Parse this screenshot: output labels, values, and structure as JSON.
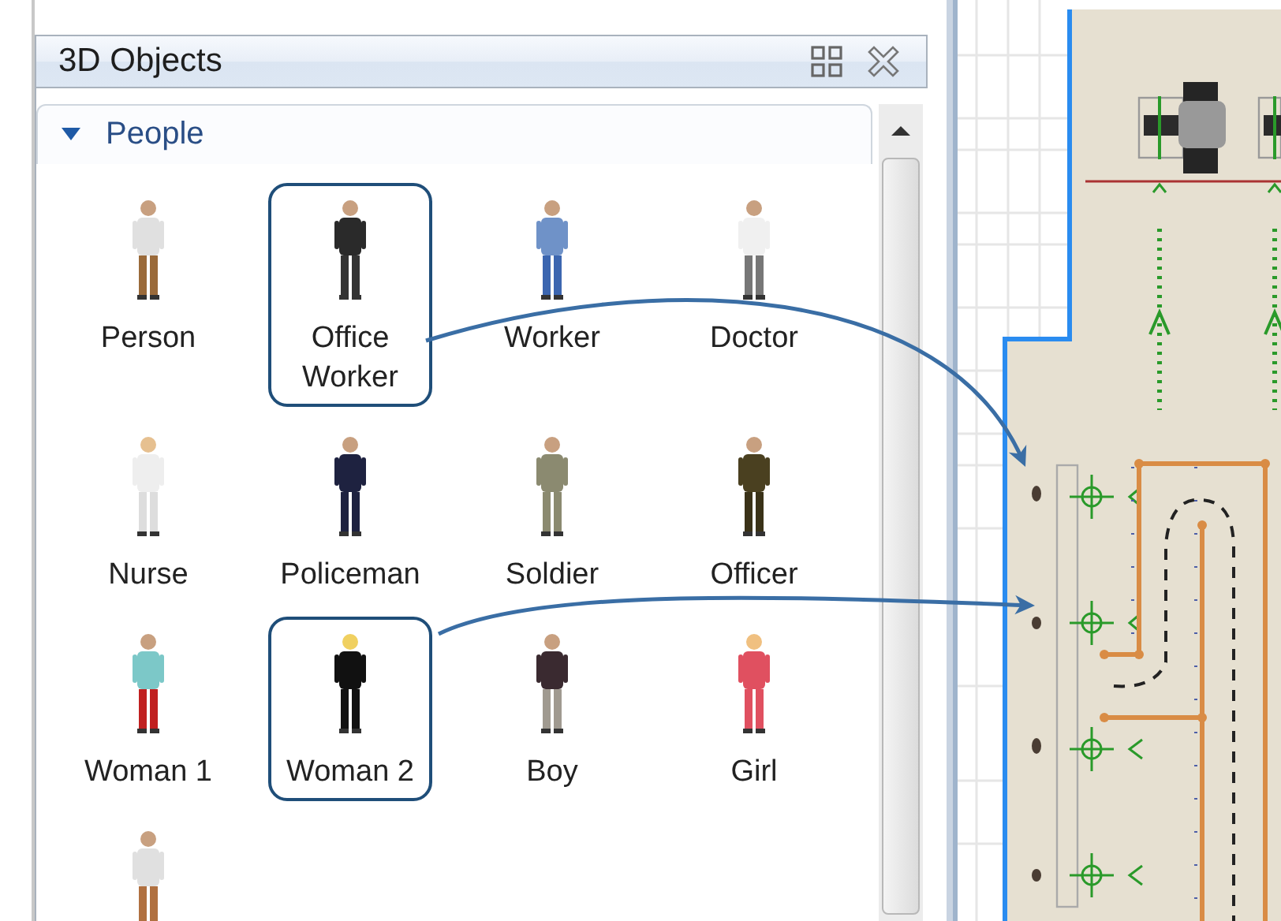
{
  "panel": {
    "title": "3D Objects"
  },
  "section": {
    "title": "People",
    "expanded": true
  },
  "items": [
    {
      "label": "Person",
      "callout": false
    },
    {
      "label": "Office Worker",
      "callout": true
    },
    {
      "label": "Worker",
      "callout": false
    },
    {
      "label": "Doctor",
      "callout": false
    },
    {
      "label": "Nurse",
      "callout": false
    },
    {
      "label": "Policeman",
      "callout": false
    },
    {
      "label": "Soldier",
      "callout": false
    },
    {
      "label": "Officer",
      "callout": false
    },
    {
      "label": "Woman 1",
      "callout": false
    },
    {
      "label": "Woman 2",
      "callout": true
    },
    {
      "label": "Boy",
      "callout": false
    },
    {
      "label": "Girl",
      "callout": false
    },
    {
      "callout": false
    }
  ]
}
